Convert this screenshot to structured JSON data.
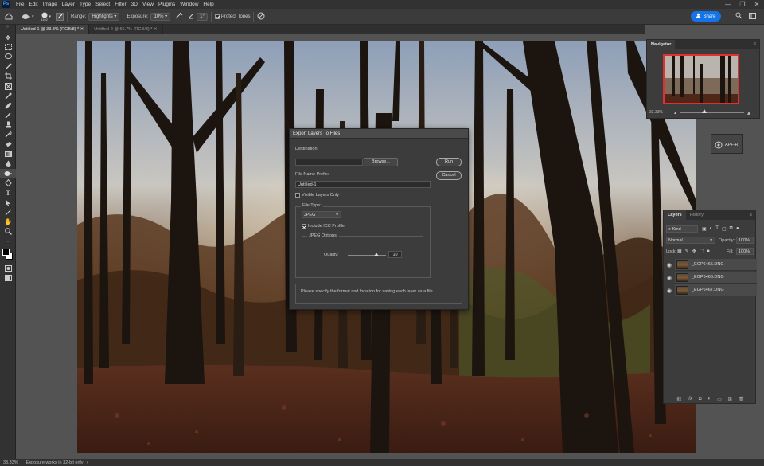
{
  "app": {
    "logo": "Ps"
  },
  "menu": [
    "File",
    "Edit",
    "Image",
    "Layer",
    "Type",
    "Select",
    "Filter",
    "3D",
    "View",
    "Plugins",
    "Window",
    "Help"
  ],
  "window_controls": {
    "minimize": "—",
    "restore": "❐",
    "close": "✕"
  },
  "options": {
    "brush_size": "1102",
    "range_label": "Range:",
    "range_value": "Highlights",
    "exposure_label": "Exposure:",
    "exposure_value": "10%",
    "angle_value": "1°",
    "protect_tones": "Protect Tones"
  },
  "share": {
    "label": "Share"
  },
  "tabs": [
    {
      "label": "Untitled-1 @ 33.3% (RGB/8) *"
    },
    {
      "label": "Untitled-2 @ 66.7% (RGB/8) *"
    }
  ],
  "dialog": {
    "title": "Export Layers To Files",
    "destination_label": "Destination:",
    "destination_value": "",
    "browse": "Browse...",
    "run": "Run",
    "cancel": "Cancel",
    "prefix_label": "File Name Prefix:",
    "prefix_value": "Untitled-1",
    "visible_only": "Visible Layers Only",
    "filetype_label": "File Type:",
    "filetype_value": "JPEG",
    "icc": "Include ICC Profile",
    "jpeg_options": "JPEG Options:",
    "quality_label": "Quality:",
    "quality_value": "10",
    "message": "Please specify the format and location for saving each layer as a file."
  },
  "navigator": {
    "title": "Navigator",
    "zoom": "33.33%"
  },
  "apf": {
    "label": "APF-R"
  },
  "layers_panel": {
    "tabs": [
      "Layers",
      "History"
    ],
    "kind": "Kind",
    "blend_mode": "Normal",
    "opacity_label": "Opacity:",
    "opacity_value": "100%",
    "lock_label": "Lock:",
    "fill_label": "Fill:",
    "fill_value": "100%",
    "layers": [
      "_EGP6465.DNG",
      "_EGP6466.DNG",
      "_EGP6467.DNG"
    ],
    "footer_icons": [
      "link-icon",
      "fx-icon",
      "mask-icon",
      "adjustment-icon",
      "group-icon",
      "new-layer-icon",
      "trash-icon"
    ]
  },
  "status": {
    "zoom": "33.33%",
    "message": "Exposure works in 32-bit only"
  },
  "colors": {
    "accent": "#1473e6",
    "nav_frame": "#e03030",
    "bg": "#535353",
    "panel": "#3c3c3c"
  }
}
